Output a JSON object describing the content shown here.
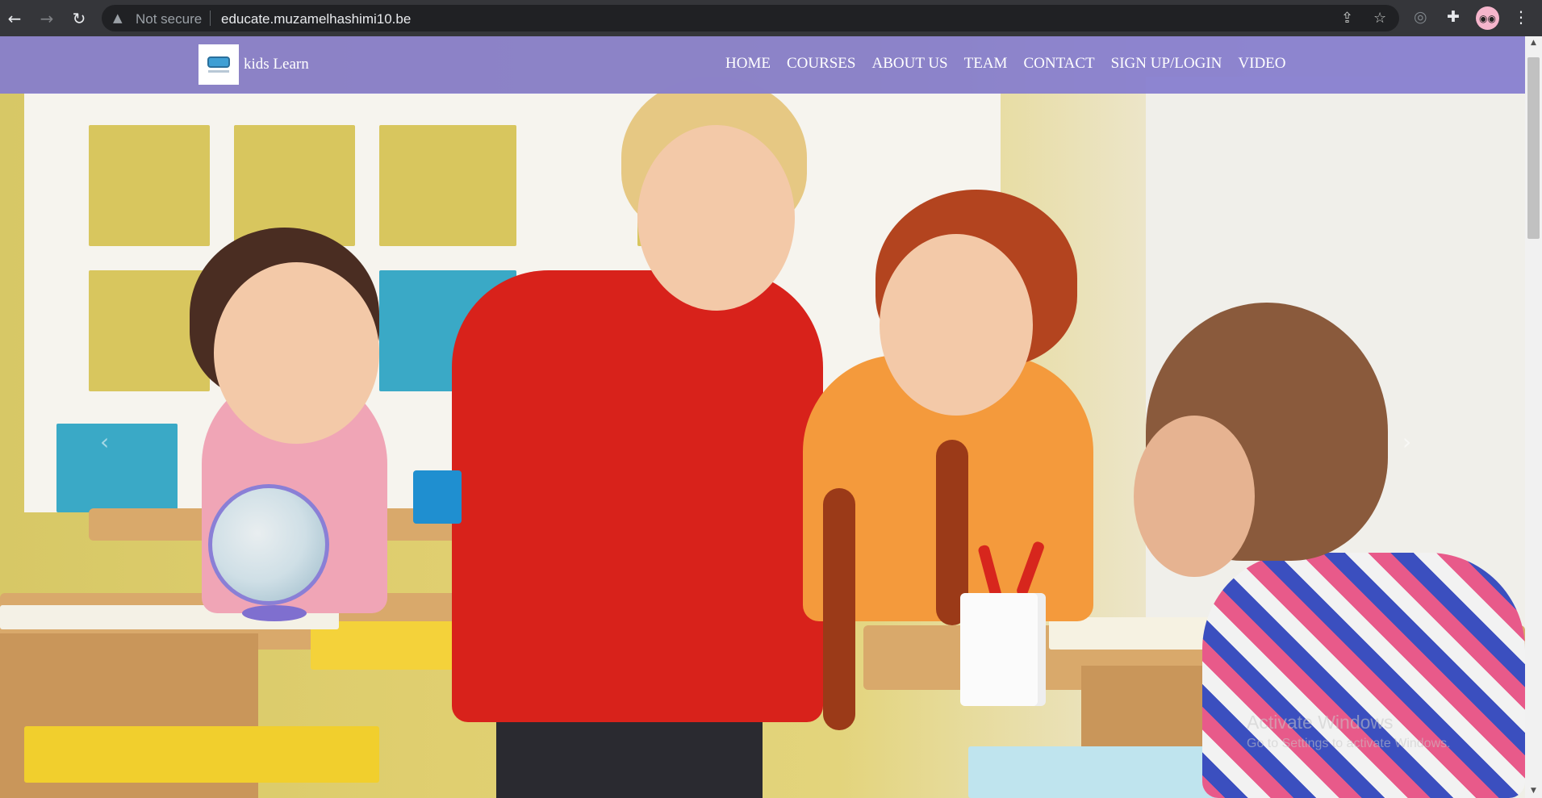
{
  "browser": {
    "back_icon": "←",
    "forward_icon": "→",
    "reload_icon": "↻",
    "security_icon": "▲",
    "security_label": "Not secure",
    "url": "educate.muzamelhashimi10.be",
    "share_icon": "⇪",
    "bookmark_icon": "☆",
    "extension_icon_1": "◎",
    "extensions_icon": "✚",
    "profile_icon": "◉◉",
    "menu_icon": "⋮"
  },
  "site": {
    "brand_name": "kids Learn",
    "nav": {
      "home": "HOME",
      "courses": "COURSES",
      "about": "ABOUT US",
      "team": "TEAM",
      "contact": "CONTACT",
      "signup": "SIGN UP/LOGIN",
      "video": "VIDEO"
    },
    "nav_bg_color": "#847cce",
    "carousel": {
      "prev_icon": "‹",
      "next_icon": "›"
    }
  },
  "os_watermark": {
    "title": "Activate Windows",
    "subtitle": "Go to Settings to activate Windows."
  },
  "scrollbar": {
    "up_icon": "▲",
    "down_icon": "▼"
  }
}
